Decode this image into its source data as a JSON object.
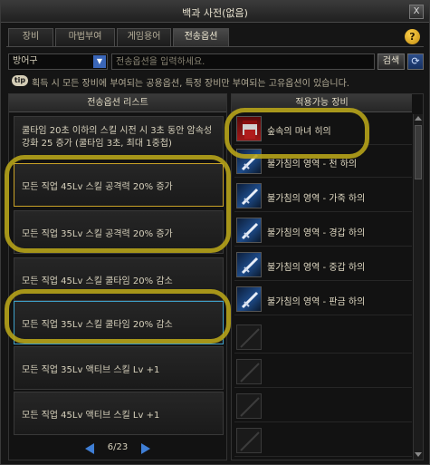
{
  "window": {
    "title": "백과 사전(없음)",
    "close_label": "X"
  },
  "tabs": [
    {
      "label": "장비",
      "active": false
    },
    {
      "label": "마법부여",
      "active": false
    },
    {
      "label": "게임용어",
      "active": false
    },
    {
      "label": "전송옵션",
      "active": true
    }
  ],
  "help_label": "?",
  "search": {
    "category": "방어구",
    "placeholder": "전송옵션을 입력하세요.",
    "button": "검색",
    "refresh_icon": "refresh-icon"
  },
  "tip": {
    "badge": "tip",
    "text": "획득 시 모든 장비에 부여되는 공용옵션, 특정 장비만 부여되는 고유옵션이 있습니다."
  },
  "options_panel": {
    "header": "전송옵션 리스트",
    "items": [
      "쿨타임 20초 이하의 스킬 시전 시 3초 동안 암속성 강화 25 증가 (쿨타임 3초, 최대 1중첩)",
      "모든 직업 45Lv 스킬 공격력 20% 증가",
      "모든 직업 35Lv 스킬 공격력 20% 증가",
      "모든 직업 45Lv 스킬 쿨타임 20% 감소",
      "모든 직업 35Lv 스킬 쿨타임 20% 감소",
      "모든 직업 35Lv 액티브 스킬 Lv +1",
      "모든 직업 45Lv 액티브 스킬 Lv +1"
    ],
    "page": "6/23"
  },
  "equipment_panel": {
    "header": "적용가능 장비",
    "items": [
      {
        "name": "숲속의 마녀 히의",
        "icon": "witch-hat-icon"
      },
      {
        "name": "불가침의 영역 - 천 하의",
        "icon": "sword-icon"
      },
      {
        "name": "불가침의 영역 - 가죽 하의",
        "icon": "sword-icon"
      },
      {
        "name": "불가침의 영역 - 경갑 하의",
        "icon": "sword-icon"
      },
      {
        "name": "불가침의 영역 - 중갑 하의",
        "icon": "sword-icon"
      },
      {
        "name": "불가침의 영역 - 판금 하의",
        "icon": "sword-icon"
      }
    ],
    "empty_slots": 4
  },
  "colors": {
    "highlight": "#b6a319",
    "accent_blue": "#3f7fd6",
    "selected_border": "#c9a227",
    "hover_border": "#3ea0c8"
  }
}
